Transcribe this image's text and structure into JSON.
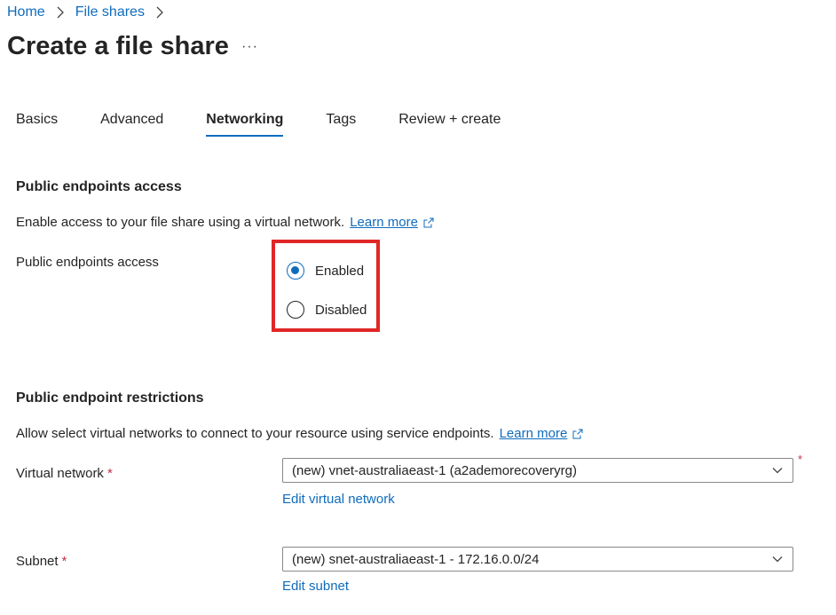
{
  "breadcrumb": {
    "home": "Home",
    "file_shares": "File shares"
  },
  "page": {
    "title": "Create a file share",
    "more": "···"
  },
  "tabs": [
    {
      "label": "Basics",
      "active": false
    },
    {
      "label": "Advanced",
      "active": false
    },
    {
      "label": "Networking",
      "active": true
    },
    {
      "label": "Tags",
      "active": false
    },
    {
      "label": "Review + create",
      "active": false
    }
  ],
  "public_endpoints": {
    "heading": "Public endpoints access",
    "description": "Enable access to your file share using a virtual network.",
    "learn_more": "Learn more",
    "field_label": "Public endpoints access",
    "options": [
      {
        "label": "Enabled",
        "checked": true
      },
      {
        "label": "Disabled",
        "checked": false
      }
    ]
  },
  "restrictions": {
    "heading": "Public endpoint restrictions",
    "description": "Allow select virtual networks to connect to your resource using service endpoints.",
    "learn_more": "Learn more",
    "virtual_network": {
      "label": "Virtual network",
      "required_mark": "*",
      "value": "(new) vnet-australiaeast-1 (a2ademorecoveryrg)",
      "edit_link": "Edit virtual network"
    },
    "subnet": {
      "label": "Subnet",
      "required_mark": "*",
      "value": "(new) snet-australiaeast-1 - 172.16.0.0/24",
      "edit_link": "Edit subnet"
    }
  },
  "colors": {
    "accent": "#0f6cbd",
    "highlight": "#e02626",
    "required": "#c4314b"
  }
}
